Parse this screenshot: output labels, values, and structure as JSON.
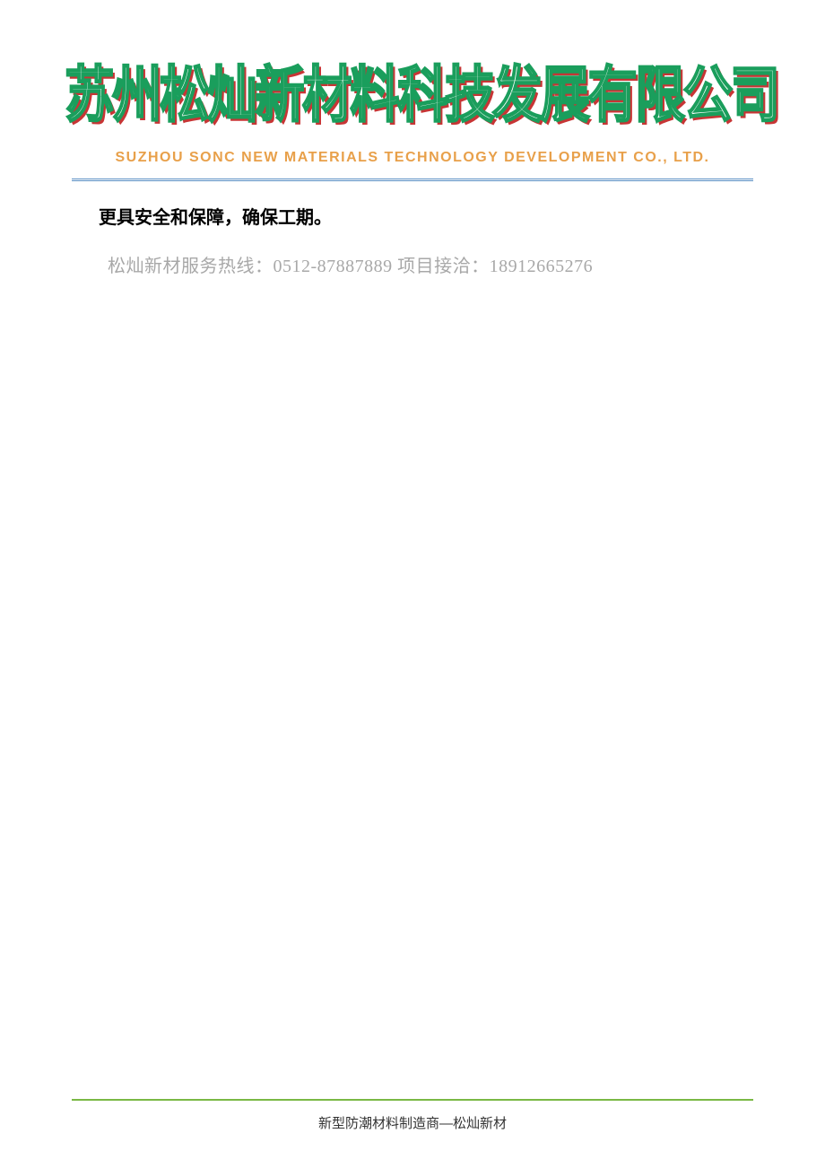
{
  "header": {
    "company_cn": "苏州松灿新材料科技发展有限公司",
    "company_en": "SUZHOU SONC NEW MATERIALS TECHNOLOGY DEVELOPMENT CO., LTD."
  },
  "body": {
    "line1": "更具安全和保障，确保工期。",
    "line2": "松灿新材服务热线：0512-87887889 项目接洽：18912665276"
  },
  "footer": {
    "text": "新型防潮材料制造商—松灿新材"
  }
}
